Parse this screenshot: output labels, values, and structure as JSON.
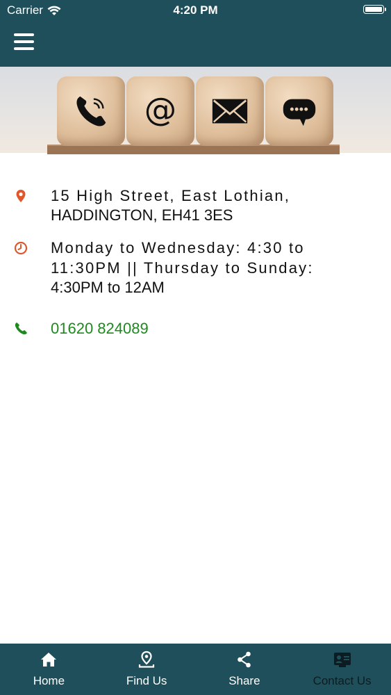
{
  "status_bar": {
    "carrier": "Carrier",
    "time": "4:20 PM"
  },
  "header": {
    "menu_icon": "hamburger-menu-icon"
  },
  "banner": {
    "icons": [
      "phone-icon",
      "at-sign-icon",
      "envelope-icon",
      "chat-bubble-icon"
    ]
  },
  "contact": {
    "address": {
      "icon": "location-pin-icon",
      "line1": "15 High Street, East Lothian,",
      "line2": "HADDINGTON, EH41 3ES"
    },
    "hours": {
      "icon": "clock-icon",
      "line1": "Monday to Wednesday: 4:30 to",
      "line2": "11:30PM || Thursday to Sunday:",
      "line3": "4:30PM to 12AM"
    },
    "phone": {
      "icon": "phone-icon",
      "number": "01620 824089"
    }
  },
  "tabbar": {
    "items": [
      {
        "label": "Home",
        "icon": "home-icon"
      },
      {
        "label": "Find Us",
        "icon": "map-pin-icon"
      },
      {
        "label": "Share",
        "icon": "share-icon"
      },
      {
        "label": "Contact Us",
        "icon": "contact-card-icon",
        "active": true
      }
    ]
  },
  "colors": {
    "header_bg": "#1f4f5a",
    "accent_orange": "#e0572c",
    "phone_green": "#1e8a1e"
  }
}
